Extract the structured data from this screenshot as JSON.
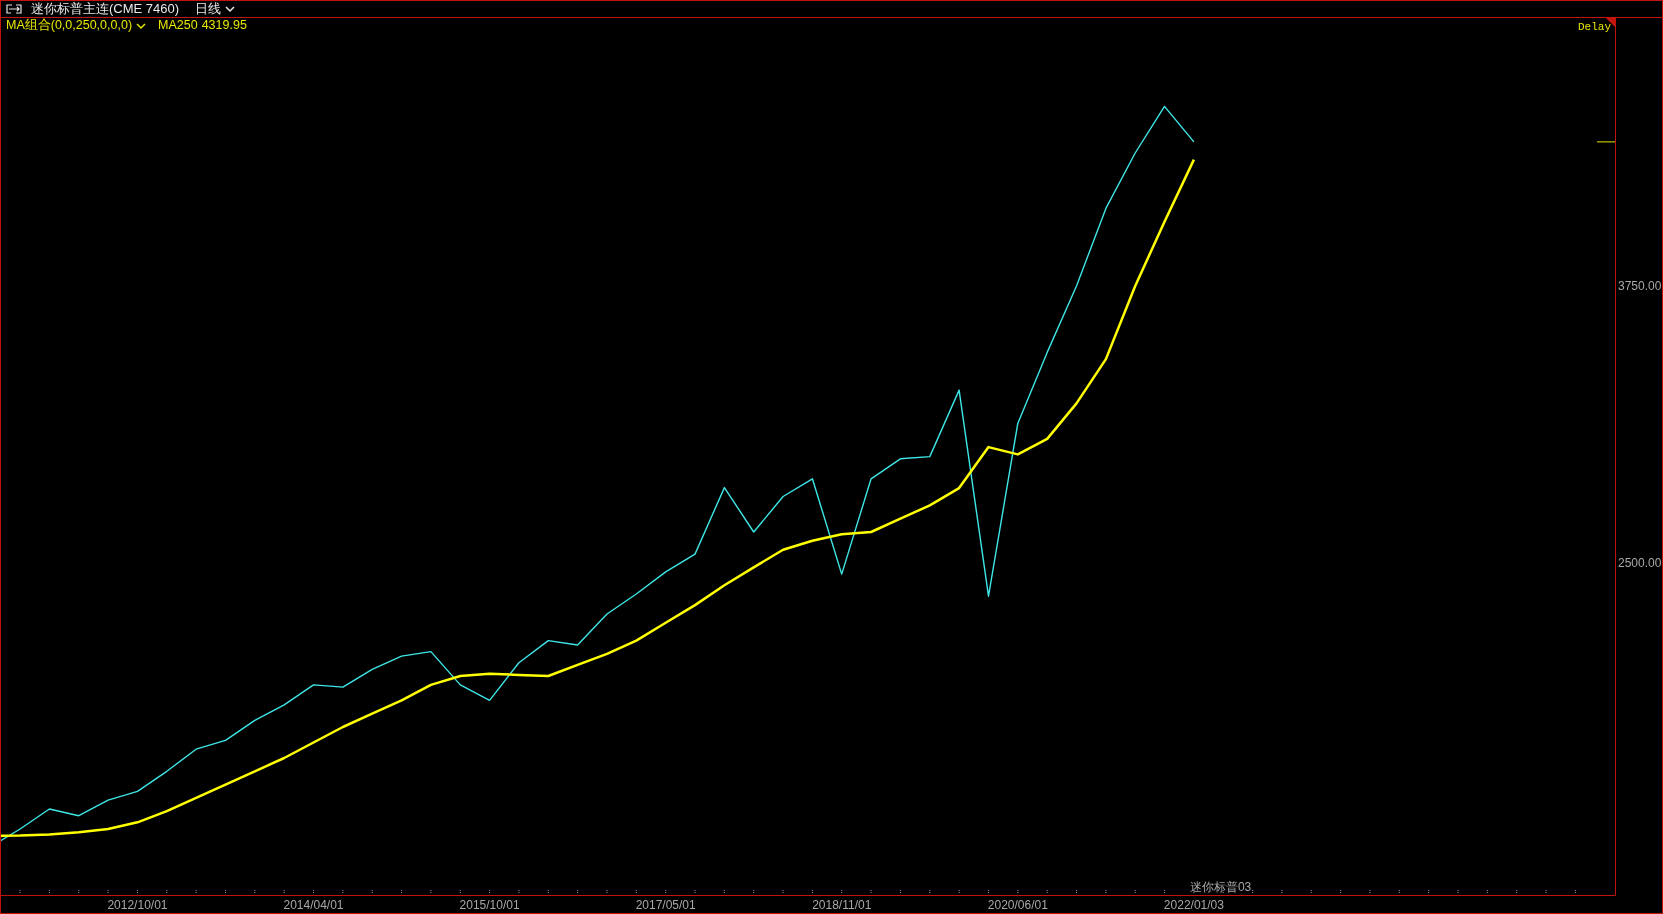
{
  "window": {
    "title": "迷你标普主连(CME 7460)",
    "period": "日线"
  },
  "indicator": {
    "name": "MA组合(0,0,250,0,0,0)",
    "reading": "4319.95"
  },
  "chart": {
    "delay": "Delay",
    "contract_label": "迷你标普03",
    "chart_data": {
      "type": "line",
      "categories": [
        null,
        null,
        null,
        null,
        null,
        "2012/10/01",
        null,
        null,
        null,
        null,
        null,
        "2014/04/01",
        null,
        null,
        null,
        null,
        null,
        "2015/10/01",
        null,
        null,
        null,
        null,
        null,
        "2017/05/01",
        null,
        null,
        null,
        null,
        null,
        "2018/11/01",
        null,
        null,
        null,
        null,
        null,
        "2020/06/01",
        null,
        null,
        null,
        null,
        null,
        "2022/01/03",
        null,
        null,
        null,
        null,
        null,
        null,
        null,
        null,
        null,
        null,
        null,
        null,
        null
      ],
      "series": [
        {
          "color": "#3ee6e6",
          "values": [
            1220,
            1300,
            1390,
            1360,
            1430,
            1470,
            1560,
            1660,
            1700,
            1790,
            1860,
            1950,
            1940,
            2020,
            2080,
            2100,
            1950,
            1880,
            2050,
            2150,
            2130,
            2270,
            2360,
            2460,
            2540,
            2840,
            2640,
            2800,
            2880,
            2450,
            2880,
            2970,
            2980,
            3280,
            2350,
            3130,
            3450,
            3750,
            4100,
            4350,
            4560,
            4400,
            null,
            null,
            null,
            null,
            null,
            null,
            null,
            null,
            null,
            null,
            null,
            null,
            null
          ]
        },
        {
          "name": "MA250",
          "color": "#ffff00",
          "values": [
            1268,
            1270,
            1275,
            1285,
            1300,
            1330,
            1380,
            1440,
            1500,
            1560,
            1620,
            1690,
            1760,
            1820,
            1880,
            1950,
            1990,
            2000,
            1995,
            1990,
            2040,
            2090,
            2150,
            2230,
            2310,
            2400,
            2480,
            2560,
            2600,
            2630,
            2640,
            2700,
            2760,
            2838,
            3023,
            2990,
            3060,
            3220,
            3420,
            3750,
            4040,
            4320,
            null,
            null,
            null,
            null,
            null,
            null,
            null,
            null,
            null,
            null,
            null,
            null,
            null
          ]
        }
      ],
      "ylim": [
        1002,
        4959
      ],
      "yticks": [
        {
          "value": 2500,
          "label": "2500.00"
        },
        {
          "value": 3750,
          "label": "3750.00"
        }
      ]
    }
  }
}
